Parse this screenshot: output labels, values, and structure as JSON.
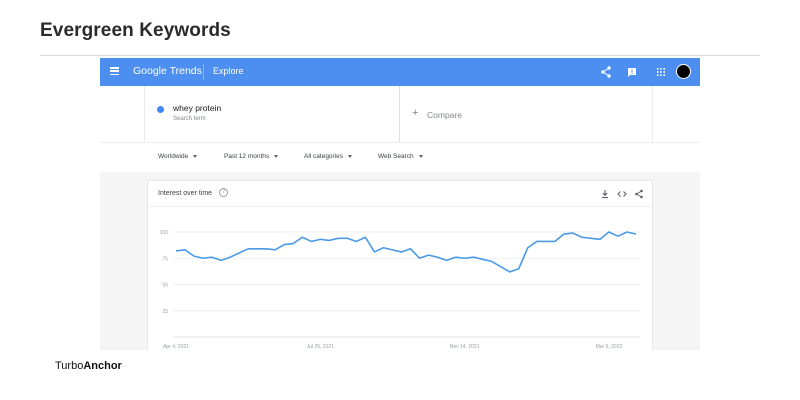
{
  "page": {
    "heading": "Evergreen Keywords"
  },
  "appbar": {
    "brand_google": "Google",
    "brand_trends": "Trends",
    "explore_label": "Explore",
    "icons": [
      "menu-icon",
      "share-icon",
      "feedback-icon",
      "apps-icon",
      "account-avatar"
    ]
  },
  "search": {
    "term": "whey protein",
    "term_subtitle": "Search term",
    "term_color": "#4285f4",
    "compare_plus": "+",
    "compare_label": "Compare"
  },
  "filters": {
    "region": "Worldwide",
    "period": "Past 12 months",
    "category": "All categories",
    "search_type": "Web Search"
  },
  "interest_card": {
    "title": "Interest over time",
    "help_glyph": "?",
    "icons": [
      "download-icon",
      "embed-icon",
      "share-icon"
    ]
  },
  "chart_data": {
    "type": "line",
    "ylim": [
      0,
      100
    ],
    "yticks": [
      "100",
      "75",
      "50",
      "25"
    ],
    "xticks": [
      "Apr 4, 2021",
      "Jul 25, 2021",
      "Nov 14, 2021",
      "Mar 6, 2022"
    ],
    "series": [
      {
        "name": "whey protein",
        "color": "#4a9ae8",
        "values": [
          82,
          83,
          77,
          75,
          76,
          73,
          76,
          80,
          84,
          84,
          84,
          83,
          88,
          89,
          95,
          91,
          93,
          92,
          94,
          94,
          91,
          95,
          81,
          85,
          83,
          81,
          84,
          75,
          78,
          76,
          73,
          76,
          75,
          76,
          74,
          72,
          67,
          62,
          65,
          85,
          91,
          91,
          91,
          98,
          99,
          95,
          94,
          93,
          100,
          96,
          100,
          98
        ]
      }
    ],
    "grid": true
  },
  "footer": {
    "logo_part1": "Turbo",
    "logo_part2": "Anchor"
  }
}
